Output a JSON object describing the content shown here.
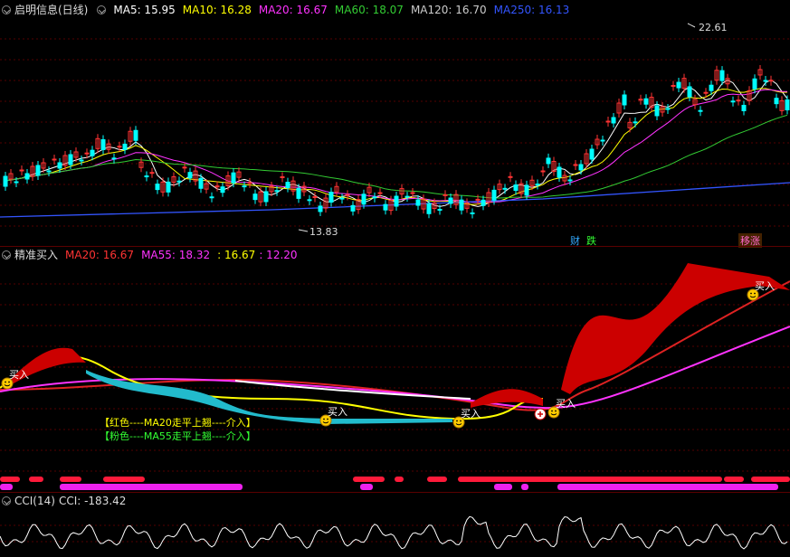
{
  "main_header": {
    "title": "启明信息(日线)",
    "items": [
      {
        "label": "MA5: 15.95",
        "color": "#ffffff"
      },
      {
        "label": "MA10: 16.28",
        "color": "#ffff00"
      },
      {
        "label": "MA20: 16.67",
        "color": "#ff33ff"
      },
      {
        "label": "MA60: 18.07",
        "color": "#33cc33"
      },
      {
        "label": "MA120: 16.70",
        "color": "#cccccc"
      },
      {
        "label": "MA250: 16.13",
        "color": "#3355ff"
      }
    ]
  },
  "price_annotations": {
    "high": "22.61",
    "low": "13.83"
  },
  "event_tags": {
    "tag1a": "财",
    "tag1b": "跌",
    "tag2": "移涨"
  },
  "indicator_header": {
    "title": "精准买入",
    "items": [
      {
        "label": "MA20: 16.67",
        "color": "#ff3333"
      },
      {
        "label": "MA55: 18.32",
        "color": "#ff33ff"
      },
      {
        "label": ": 16.67",
        "color": "#ffff00"
      },
      {
        "label": ": 12.20",
        "color": "#ff33ff"
      }
    ]
  },
  "buy_label": "买入",
  "legend_lines": {
    "line1": "【红色----MA20走平上翘----介入】",
    "line2": "【粉色----MA55走平上翘----介入】"
  },
  "cci_header": {
    "title": "CCI(14)",
    "value": "CCI: -183.42"
  },
  "colors": {
    "up": "#ff3333",
    "down": "#00ffff",
    "grid": "#550000",
    "bg": "#000000"
  }
}
